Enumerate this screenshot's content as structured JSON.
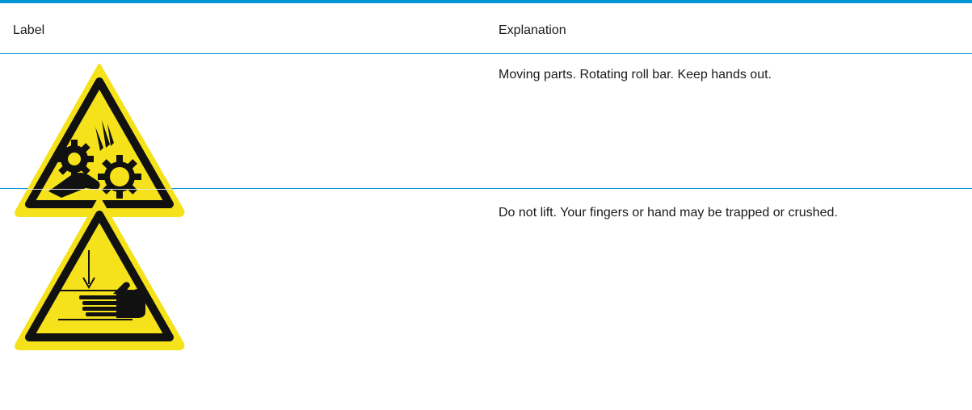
{
  "header": {
    "label_col": "Label",
    "explanation_col": "Explanation"
  },
  "rows": [
    {
      "icon": "pinch-point-gears-warning-icon",
      "explanation": "Moving parts. Rotating roll bar. Keep hands out."
    },
    {
      "icon": "hand-crush-warning-icon",
      "explanation": "Do not lift. Your fingers or hand may be trapped or crushed."
    }
  ],
  "colors": {
    "rule": "#0096d6",
    "warning_yellow": "#f5e21b",
    "warning_black": "#111111"
  }
}
